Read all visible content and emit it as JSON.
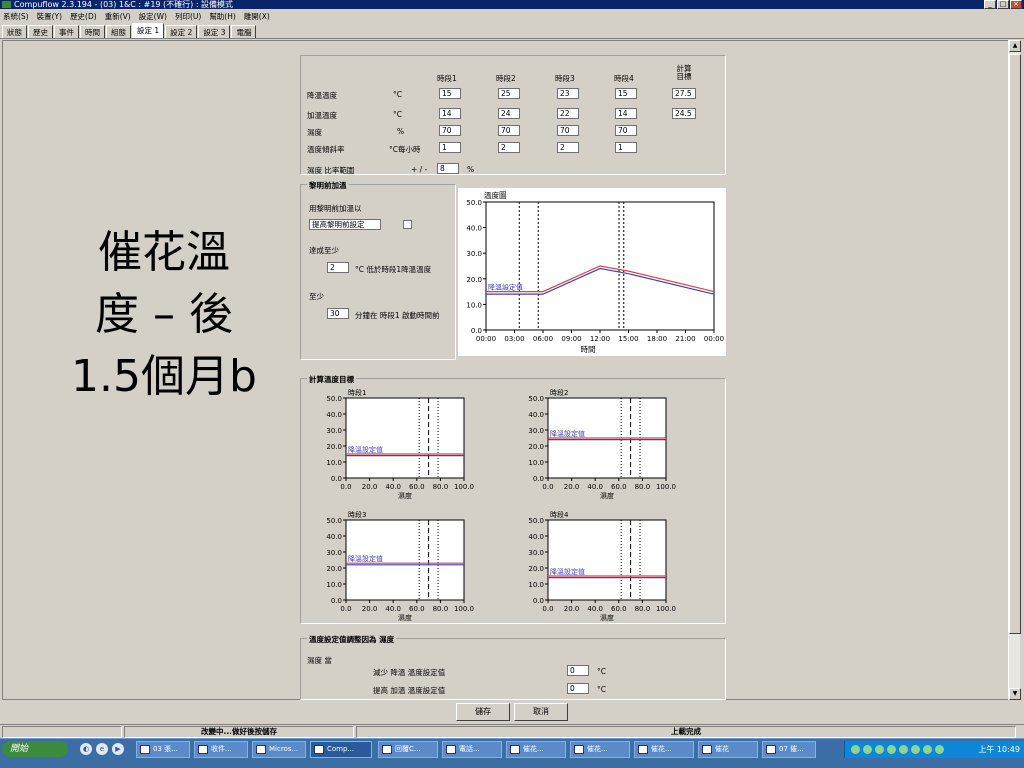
{
  "window": {
    "title": "Compuflow 2.3.194 - (03) 1&C : #19 (不確行) : 設備模式"
  },
  "menu": [
    "系統(S)",
    "裝置(Y)",
    "歷史(D)",
    "重新(V)",
    "設定(W)",
    "列印(U)",
    "幫助(H)",
    "離開(X)"
  ],
  "tabs": [
    {
      "label": "狀態"
    },
    {
      "label": "歷史"
    },
    {
      "label": "事件"
    },
    {
      "label": "時間"
    },
    {
      "label": "組態"
    },
    {
      "label": "設定 1"
    },
    {
      "label": "設定 2"
    },
    {
      "label": "設定 3"
    },
    {
      "label": "電腦"
    }
  ],
  "active_tab_index": 5,
  "overlay": {
    "line1": "催花溫",
    "line2": "度 – 後",
    "line3": "1.5個月b"
  },
  "schedule": {
    "headers": [
      "時段1",
      "時段2",
      "時段3",
      "時段4"
    ],
    "target_header": "計算目標",
    "rows": [
      {
        "label": "降溫溫度",
        "unit": "°C",
        "values": [
          "15",
          "25",
          "23",
          "15"
        ],
        "target": "27.5"
      },
      {
        "label": "加溫溫度",
        "unit": "°C",
        "values": [
          "14",
          "24",
          "22",
          "14"
        ],
        "target": "24.5"
      },
      {
        "label": "濕度",
        "unit": "%",
        "values": [
          "70",
          "70",
          "70",
          "70"
        ],
        "target": ""
      },
      {
        "label": "溫度傾斜率",
        "unit": "°C每小時",
        "values": [
          "1",
          "2",
          "2",
          "1"
        ],
        "target": ""
      }
    ],
    "humidity_range": {
      "label": "濕度 比率範圍",
      "prefix": "+ / -",
      "value": "8",
      "unit": "%"
    }
  },
  "predawn": {
    "title": "黎明前加溫",
    "enable_label": "用黎明前加溫以",
    "enable_field": "提高黎明前設定",
    "decrease_label": "達成至少",
    "decrease_value": "2",
    "decrease_unit": "°C 低於時段1降溫溫度",
    "lead_label": "至少",
    "lead_value": "30",
    "lead_unit": "分鐘在 時段1 啟動時間前"
  },
  "temp_chart": {
    "title": "溫度圖",
    "series_label": "降溫設定值",
    "xlabel": "時間",
    "yticks": [
      "50.0",
      "40.0",
      "30.0",
      "20.0",
      "10.0",
      "0.0"
    ],
    "xticks": [
      "00:00",
      "03:00",
      "06:00",
      "09:00",
      "12:00",
      "15:00",
      "18:00",
      "21:00",
      "00:00"
    ]
  },
  "calc_group": {
    "title": "計算溫度目標"
  },
  "mini_charts": [
    {
      "title": "時段1",
      "series_label": "降溫設定值",
      "xlabel": "濕度"
    },
    {
      "title": "時段2",
      "series_label": "降溫設定值",
      "xlabel": "濕度"
    },
    {
      "title": "時段3",
      "series_label": "降溫設定值",
      "xlabel": "濕度"
    },
    {
      "title": "時段4",
      "series_label": "降溫設定值",
      "xlabel": "濕度"
    }
  ],
  "mini_axis": {
    "yticks": [
      "50.0",
      "40.0",
      "30.0",
      "20.0",
      "10.0",
      "0.0"
    ],
    "xticks": [
      "0.0",
      "20.0",
      "40.0",
      "60.0",
      "80.0",
      "100.0"
    ]
  },
  "adjust": {
    "title": "溫度設定值調整因為 濕度",
    "sub": "濕度 當",
    "row1_label": "減少 降溫 溫度設定值",
    "row1_value": "0",
    "row1_unit": "°C",
    "row2_label": "提高 加溫 溫度設定值",
    "row2_value": "0",
    "row2_unit": "°C"
  },
  "buttons": {
    "save": "儲存",
    "cancel": "取消"
  },
  "status": {
    "left": "改變中...做好後按儲存",
    "right": "上載完成"
  },
  "taskbar": {
    "start": "開始",
    "items": [
      "03 張...",
      "收件...",
      "Micros...",
      "Comp...",
      "回覆C...",
      "電話...",
      "催花...",
      "催花...",
      "催花...",
      "催花",
      "07 催..."
    ],
    "clock": "上午 10:49"
  },
  "chart_data": [
    {
      "type": "line",
      "title": "溫度圖",
      "xlabel": "時間",
      "ylabel": "",
      "xticks": [
        "00:00",
        "03:00",
        "06:00",
        "09:00",
        "12:00",
        "15:00",
        "18:00",
        "21:00",
        "00:00"
      ],
      "ylim": [
        0,
        50
      ],
      "x": [
        0,
        4,
        6,
        12,
        15,
        24
      ],
      "series": [
        {
          "name": "降溫設定值",
          "color": "#e04040",
          "values": [
            15,
            15,
            15,
            25,
            23,
            15
          ]
        },
        {
          "color": "#4040c0",
          "values": [
            14,
            14,
            14,
            24,
            22,
            14
          ]
        }
      ],
      "period_starts_hours": [
        3.5,
        5.5,
        14.0,
        14.5
      ]
    },
    {
      "type": "line",
      "title": "時段1",
      "xlabel": "濕度",
      "ylim": [
        0,
        50
      ],
      "xlim": [
        0,
        100
      ],
      "cooling_setpoint": 15,
      "heating_setpoint": 14,
      "humidity_marker": 70,
      "humidity_range": [
        62,
        78
      ]
    },
    {
      "type": "line",
      "title": "時段2",
      "xlabel": "濕度",
      "ylim": [
        0,
        50
      ],
      "xlim": [
        0,
        100
      ],
      "cooling_setpoint": 25,
      "heating_setpoint": 24,
      "humidity_marker": 70,
      "humidity_range": [
        62,
        78
      ]
    },
    {
      "type": "line",
      "title": "時段3",
      "xlabel": "濕度",
      "ylim": [
        0,
        50
      ],
      "xlim": [
        0,
        100
      ],
      "cooling_setpoint": 23,
      "heating_setpoint": 22,
      "humidity_marker": 70,
      "humidity_range": [
        62,
        78
      ]
    },
    {
      "type": "line",
      "title": "時段4",
      "xlabel": "濕度",
      "ylim": [
        0,
        50
      ],
      "xlim": [
        0,
        100
      ],
      "cooling_setpoint": 15,
      "heating_setpoint": 14,
      "humidity_marker": 70,
      "humidity_range": [
        62,
        78
      ]
    }
  ]
}
